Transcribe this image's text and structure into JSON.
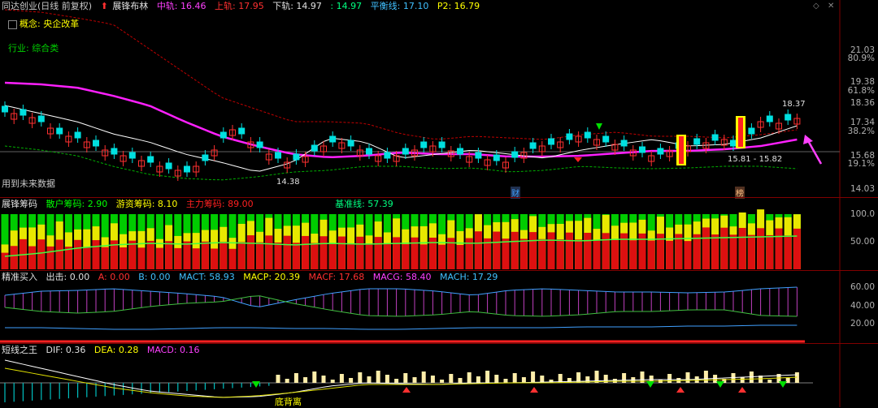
{
  "main": {
    "stock_title": "同达创业(日线 前复权)",
    "indicator_name": "展锋布林",
    "mid": "中轨: 16.46",
    "upper": "上轨: 17.95",
    "lower": "下轨: 14.97",
    "extra": ": 14.97",
    "balance": "平衡线: 17.10",
    "p2": "P2: 16.79",
    "concept": "概念: 央企改革",
    "industry": "行业: 综合类",
    "future_note": "用到未来数据",
    "low_label": "14.38",
    "high_label": "18.37",
    "range_label": "15.81 - 15.82",
    "marker_cai": "财",
    "marker_bang": "榜",
    "axis_labels": [
      "21.03",
      "80.9%",
      "19.38",
      "61.8%",
      "18.36",
      "17.34",
      "38.2%",
      "15.68",
      "19.1%",
      "14.03"
    ],
    "colors": {
      "up": "#ff3030",
      "down": "#00ffff",
      "mid": "#ff00ff",
      "upper": "#ff3030",
      "lower": "#00c000",
      "white": "#ffffff"
    }
  },
  "chip": {
    "title": "展锋筹码",
    "retail": "散户筹码: 2.90",
    "hot": "游资筹码: 8.10",
    "main_force": "主力筹码: 89.00",
    "base": "基准线: 57.39",
    "axis_labels": [
      "100.0",
      "50.00"
    ]
  },
  "precise": {
    "title": "精准买入",
    "out": "出击: 0.00",
    "a": "A: 0.00",
    "b": "B: 0.00",
    "mact": "MACT: 58.93",
    "macp": "MACP: 20.39",
    "macf": "MACF: 17.68",
    "macg": "MACG: 58.40",
    "mach": "MACH: 17.29",
    "axis_labels": [
      "60.00",
      "40.00",
      "20.00"
    ]
  },
  "short": {
    "title": "短线之王",
    "dif": "DIF: 0.36",
    "dea": "DEA: 0.28",
    "macd": "MACD: 0.16",
    "divergence": "底背离"
  },
  "toolbar": {
    "diamond": "◇",
    "close": "✕"
  }
}
